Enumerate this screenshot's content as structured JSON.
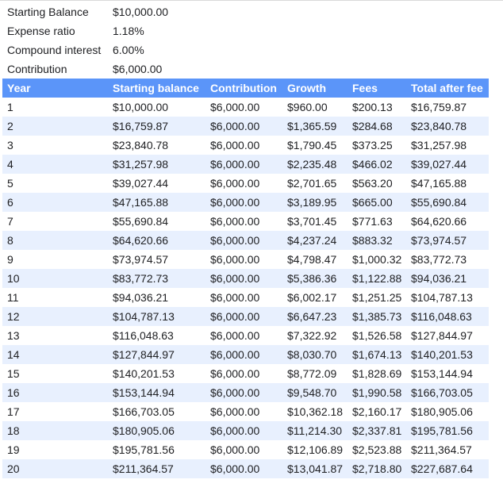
{
  "summary": [
    {
      "label": "Starting Balance",
      "value": "$10,000.00"
    },
    {
      "label": "Expense ratio",
      "value": "1.18%"
    },
    {
      "label": "Compound interest",
      "value": "6.00%"
    },
    {
      "label": "Contribution",
      "value": "$6,000.00"
    }
  ],
  "table": {
    "headers": [
      "Year",
      "Starting balance",
      "Contribution",
      "Growth",
      "Fees",
      "Total after fee"
    ],
    "rows": [
      [
        "1",
        "$10,000.00",
        "$6,000.00",
        "$960.00",
        "$200.13",
        "$16,759.87"
      ],
      [
        "2",
        "$16,759.87",
        "$6,000.00",
        "$1,365.59",
        "$284.68",
        "$23,840.78"
      ],
      [
        "3",
        "$23,840.78",
        "$6,000.00",
        "$1,790.45",
        "$373.25",
        "$31,257.98"
      ],
      [
        "4",
        "$31,257.98",
        "$6,000.00",
        "$2,235.48",
        "$466.02",
        "$39,027.44"
      ],
      [
        "5",
        "$39,027.44",
        "$6,000.00",
        "$2,701.65",
        "$563.20",
        "$47,165.88"
      ],
      [
        "6",
        "$47,165.88",
        "$6,000.00",
        "$3,189.95",
        "$665.00",
        "$55,690.84"
      ],
      [
        "7",
        "$55,690.84",
        "$6,000.00",
        "$3,701.45",
        "$771.63",
        "$64,620.66"
      ],
      [
        "8",
        "$64,620.66",
        "$6,000.00",
        "$4,237.24",
        "$883.32",
        "$73,974.57"
      ],
      [
        "9",
        "$73,974.57",
        "$6,000.00",
        "$4,798.47",
        "$1,000.32",
        "$83,772.73"
      ],
      [
        "10",
        "$83,772.73",
        "$6,000.00",
        "$5,386.36",
        "$1,122.88",
        "$94,036.21"
      ],
      [
        "11",
        "$94,036.21",
        "$6,000.00",
        "$6,002.17",
        "$1,251.25",
        "$104,787.13"
      ],
      [
        "12",
        "$104,787.13",
        "$6,000.00",
        "$6,647.23",
        "$1,385.73",
        "$116,048.63"
      ],
      [
        "13",
        "$116,048.63",
        "$6,000.00",
        "$7,322.92",
        "$1,526.58",
        "$127,844.97"
      ],
      [
        "14",
        "$127,844.97",
        "$6,000.00",
        "$8,030.70",
        "$1,674.13",
        "$140,201.53"
      ],
      [
        "15",
        "$140,201.53",
        "$6,000.00",
        "$8,772.09",
        "$1,828.69",
        "$153,144.94"
      ],
      [
        "16",
        "$153,144.94",
        "$6,000.00",
        "$9,548.70",
        "$1,990.58",
        "$166,703.05"
      ],
      [
        "17",
        "$166,703.05",
        "$6,000.00",
        "$10,362.18",
        "$2,160.17",
        "$180,905.06"
      ],
      [
        "18",
        "$180,905.06",
        "$6,000.00",
        "$11,214.30",
        "$2,337.81",
        "$195,781.56"
      ],
      [
        "19",
        "$195,781.56",
        "$6,000.00",
        "$12,106.89",
        "$2,523.88",
        "$211,364.57"
      ],
      [
        "20",
        "$211,364.57",
        "$6,000.00",
        "$13,041.87",
        "$2,718.80",
        "$227,687.64"
      ]
    ]
  },
  "colors": {
    "header_bg": "#5b95f9",
    "header_text": "#ffffff",
    "alt_row_bg": "#e8f0fe",
    "row_bg": "#ffffff",
    "text": "#202124"
  }
}
